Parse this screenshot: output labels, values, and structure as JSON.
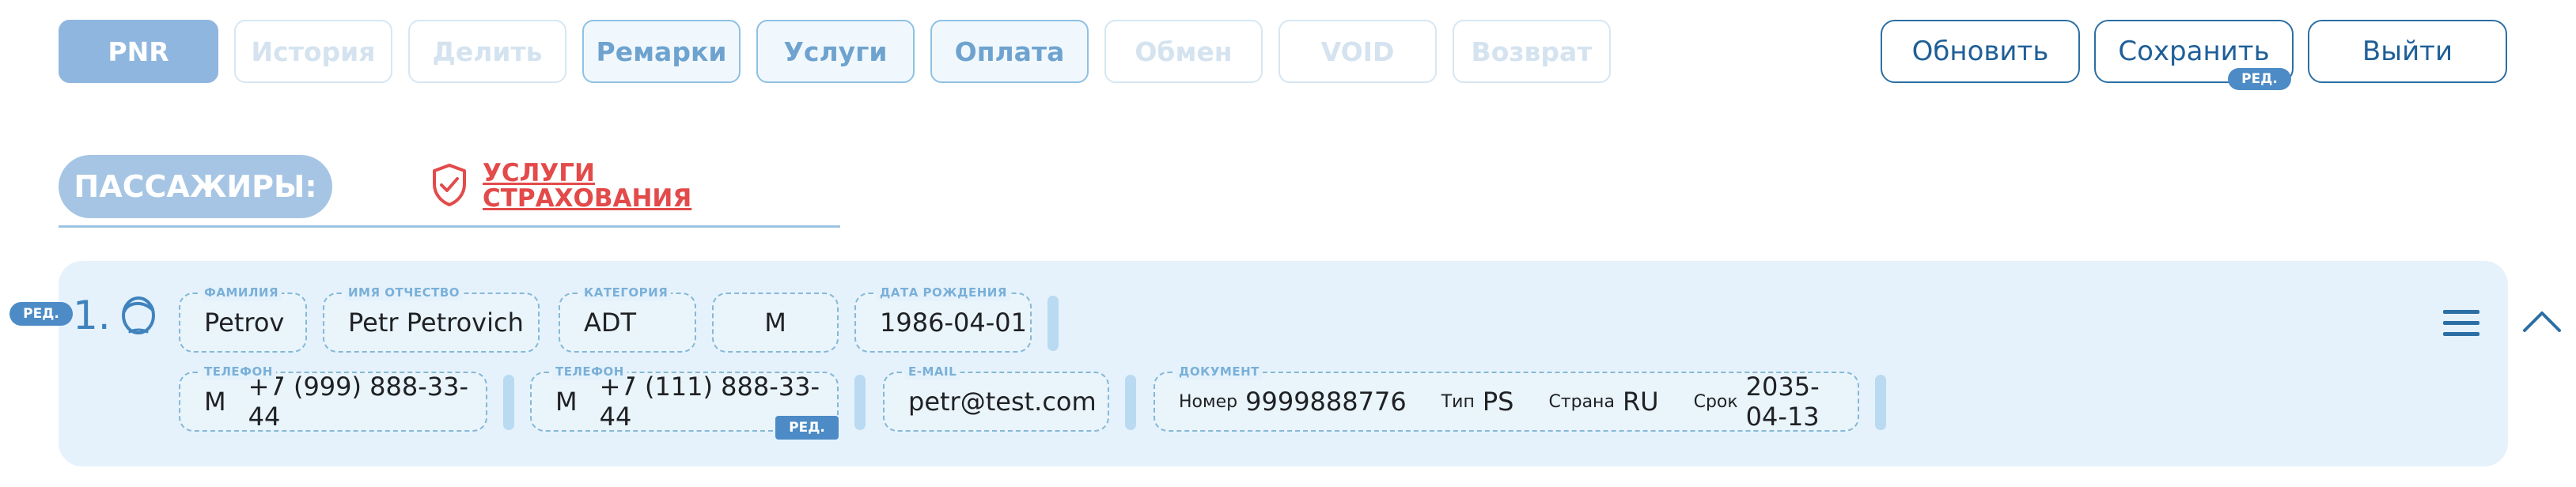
{
  "tabs": [
    {
      "label": "PNR",
      "state": "active"
    },
    {
      "label": "История",
      "state": "disabled"
    },
    {
      "label": "Делить",
      "state": "disabled"
    },
    {
      "label": "Ремарки",
      "state": "enabled"
    },
    {
      "label": "Услуги",
      "state": "enabled"
    },
    {
      "label": "Оплата",
      "state": "enabled"
    },
    {
      "label": "Обмен",
      "state": "disabled"
    },
    {
      "label": "VOID",
      "state": "disabled"
    },
    {
      "label": "Возврат",
      "state": "disabled"
    }
  ],
  "actions": {
    "refresh": "Обновить",
    "save": "Сохранить",
    "save_badge": "РЕД.",
    "exit": "Выйти"
  },
  "passengers": {
    "title": "ПАССАЖИРЫ:",
    "insurance_line1": "УСЛУГИ",
    "insurance_line2": "СТРАХОВАНИЯ"
  },
  "passenger": {
    "edit_badge": "РЕД.",
    "number": "1.",
    "surname_label": "ФАМИЛИЯ",
    "surname": "Petrov",
    "name_label": "ИМЯ ОТЧЕСТВО",
    "name": "Petr Petrovich",
    "category_label": "КАТЕГОРИЯ",
    "category": "ADT",
    "gender": "M",
    "dob_label": "ДАТА РОЖДЕНИЯ",
    "dob": "1986-04-01",
    "phone1_label": "ТЕЛЕФОН",
    "phone1_type": "M",
    "phone1": "+7 (999) 888-33-44",
    "phone2_label": "ТЕЛЕФОН",
    "phone2_type": "M",
    "phone2": "+7 (111) 888-33-44",
    "phone2_badge": "РЕД.",
    "email_label": "E-MAIL",
    "email": "petr@test.com",
    "doc_label": "ДОКУМЕНТ",
    "doc_number_label": "Номер",
    "doc_number": "9999888776",
    "doc_type_label": "Тип",
    "doc_type": "PS",
    "doc_country_label": "Страна",
    "doc_country": "RU",
    "doc_expiry_label": "Срок",
    "doc_expiry": "2035-04-13"
  },
  "icons": {
    "shield": "shield-check-icon",
    "avatar": "person-icon",
    "menu": "hamburger-menu-icon",
    "collapse": "chevron-up-icon"
  },
  "colors": {
    "accent": "#2c6fa4",
    "active_tab": "#8fb6df",
    "insurance": "#e34a4a",
    "card_bg": "#e5f2fc",
    "badge": "#4d8bc6"
  }
}
